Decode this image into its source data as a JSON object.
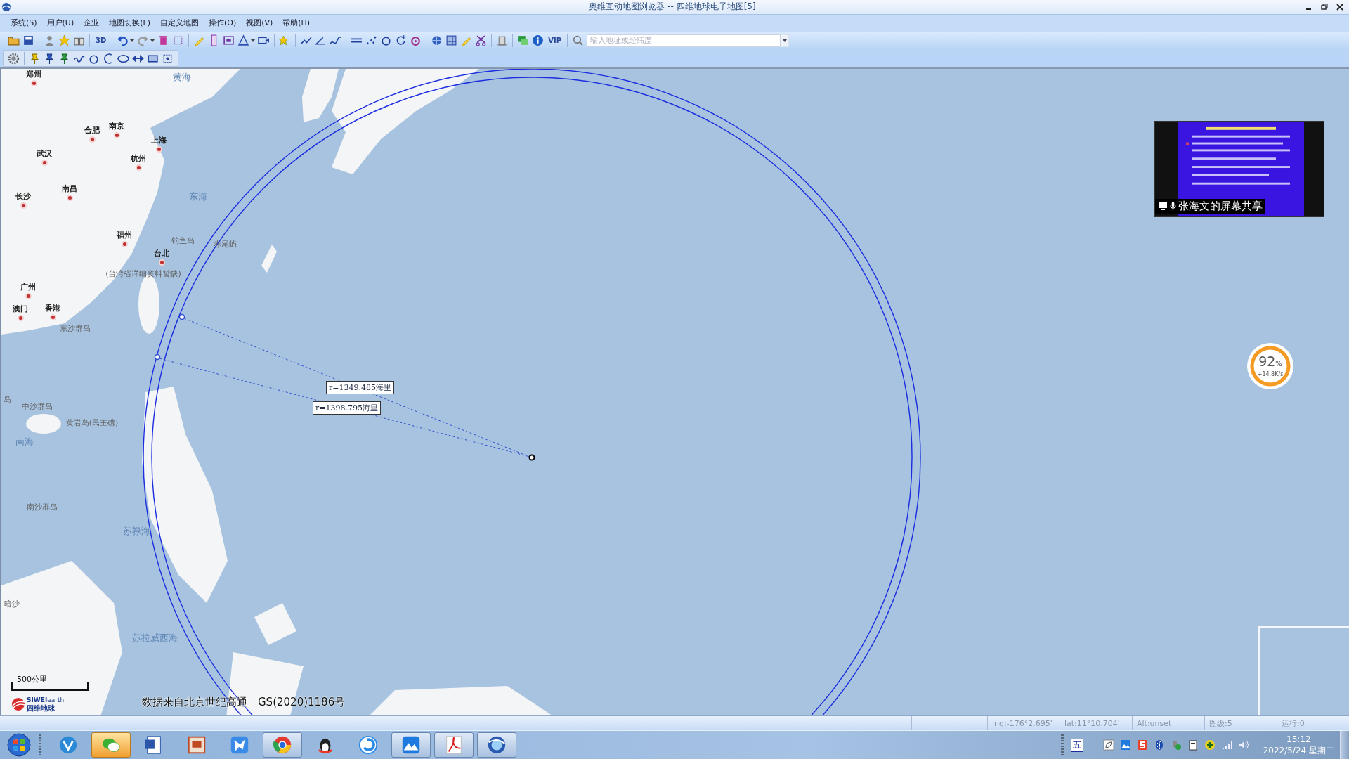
{
  "window": {
    "title": "奥维互动地图浏览器 -- 四维地球电子地图[5]"
  },
  "menu": [
    "系统(S)",
    "用户(U)",
    "企业",
    "地图切换(L)",
    "自定义地图",
    "操作(O)",
    "视图(V)",
    "帮助(H)"
  ],
  "toolbar": {
    "text_3d": "3D",
    "text_vip": "VIP",
    "search": {
      "placeholder": "输入地址或经纬度"
    }
  },
  "map": {
    "labels": [
      {
        "text": "郑州",
        "kind": "city"
      },
      {
        "text": "黄海",
        "kind": "sea"
      },
      {
        "text": "南京",
        "kind": "city"
      },
      {
        "text": "合肥",
        "kind": "city"
      },
      {
        "text": "上海",
        "kind": "city"
      },
      {
        "text": "武汉",
        "kind": "city"
      },
      {
        "text": "杭州",
        "kind": "city"
      },
      {
        "text": "南昌",
        "kind": "city"
      },
      {
        "text": "长沙",
        "kind": "city"
      },
      {
        "text": "东海",
        "kind": "sea"
      },
      {
        "text": "福州",
        "kind": "city"
      },
      {
        "text": "钓鱼岛",
        "kind": "island"
      },
      {
        "text": "赤尾屿",
        "kind": "island"
      },
      {
        "text": "台北",
        "kind": "city"
      },
      {
        "text": "(台湾省详细资料暂缺)",
        "kind": "island"
      },
      {
        "text": "广州",
        "kind": "city"
      },
      {
        "text": "澳门",
        "kind": "city"
      },
      {
        "text": "香港",
        "kind": "city"
      },
      {
        "text": "东沙群岛",
        "kind": "island"
      },
      {
        "text": "岛",
        "kind": "island"
      },
      {
        "text": "中沙群岛",
        "kind": "island"
      },
      {
        "text": "黄岩岛(民主礁)",
        "kind": "island"
      },
      {
        "text": "南海",
        "kind": "sea"
      },
      {
        "text": "南沙群岛",
        "kind": "island"
      },
      {
        "text": "苏禄海",
        "kind": "sea"
      },
      {
        "text": "暗沙",
        "kind": "island"
      },
      {
        "text": "苏拉威西海",
        "kind": "sea"
      }
    ],
    "measurements": [
      "r=1349.485海里",
      "r=1398.795海里"
    ],
    "scale": "500公里",
    "logo": {
      "name": "**SIWEI**earth",
      "subtitle": "四维地球"
    },
    "credit": "数据来自北京世纪高通　GS(2020)1186号"
  },
  "screen_share": {
    "caption": "张海文的屏幕共享"
  },
  "speed_widget": {
    "value": "92",
    "unit": "%",
    "speed": "+14.8K/s"
  },
  "status_bar": [
    "lng:-176°2.695'",
    "lat:11°10.704'",
    "Alt:unset",
    "图级:5",
    "运行:0"
  ],
  "taskbar": {
    "apps": [
      {
        "open": false,
        "flashing": false
      },
      {
        "open": true,
        "flashing": true
      },
      {
        "open": false,
        "flashing": false
      },
      {
        "open": false,
        "flashing": false
      },
      {
        "open": false,
        "flashing": false
      },
      {
        "open": true,
        "flashing": false
      },
      {
        "open": false,
        "flashing": false
      },
      {
        "open": false,
        "flashing": false
      },
      {
        "open": true,
        "flashing": false
      },
      {
        "open": true,
        "flashing": false
      },
      {
        "open": true,
        "flashing": false
      }
    ],
    "ime": "五",
    "clock": "15:12",
    "date": "2022/5/24 星期二"
  }
}
